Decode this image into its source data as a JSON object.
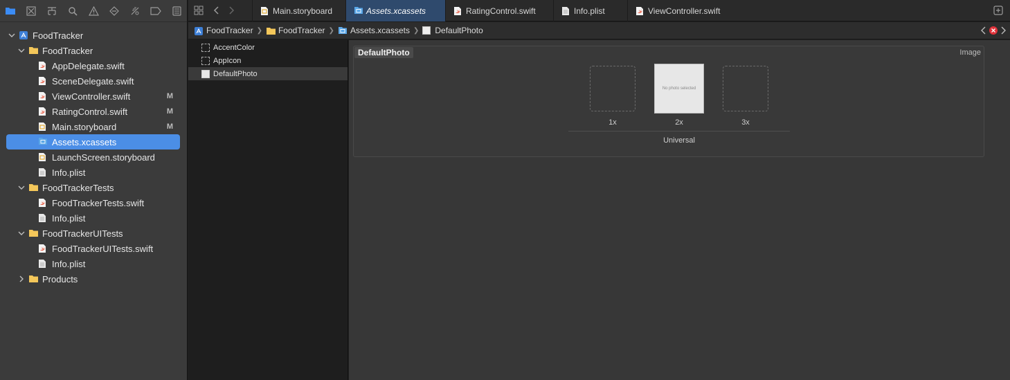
{
  "navigator_toolbar": {
    "icons": [
      "folder-icon",
      "source-control-icon",
      "symbol-icon",
      "find-icon",
      "issue-icon",
      "test-icon",
      "debug-icon",
      "breakpoint-icon",
      "report-icon"
    ]
  },
  "tree": [
    {
      "label": "FoodTracker",
      "kind": "project",
      "level": 0,
      "expanded": true
    },
    {
      "label": "FoodTracker",
      "kind": "folder",
      "level": 1,
      "expanded": true
    },
    {
      "label": "AppDelegate.swift",
      "kind": "swift",
      "level": 2
    },
    {
      "label": "SceneDelegate.swift",
      "kind": "swift",
      "level": 2
    },
    {
      "label": "ViewController.swift",
      "kind": "swift",
      "level": 2,
      "badge": "M"
    },
    {
      "label": "RatingControl.swift",
      "kind": "swift",
      "level": 2,
      "badge": "M"
    },
    {
      "label": "Main.storyboard",
      "kind": "storyboard",
      "level": 2,
      "badge": "M"
    },
    {
      "label": "Assets.xcassets",
      "kind": "assets",
      "level": 2,
      "selected": true
    },
    {
      "label": "LaunchScreen.storyboard",
      "kind": "storyboard",
      "level": 2
    },
    {
      "label": "Info.plist",
      "kind": "plist",
      "level": 2
    },
    {
      "label": "FoodTrackerTests",
      "kind": "folder",
      "level": 1,
      "expanded": true
    },
    {
      "label": "FoodTrackerTests.swift",
      "kind": "swift",
      "level": 2
    },
    {
      "label": "Info.plist",
      "kind": "plist",
      "level": 2
    },
    {
      "label": "FoodTrackerUITests",
      "kind": "folder",
      "level": 1,
      "expanded": true
    },
    {
      "label": "FoodTrackerUITests.swift",
      "kind": "swift",
      "level": 2
    },
    {
      "label": "Info.plist",
      "kind": "plist",
      "level": 2
    },
    {
      "label": "Products",
      "kind": "folder",
      "level": 1,
      "expanded": false
    }
  ],
  "tabs": [
    {
      "label": "Main.storyboard",
      "kind": "storyboard"
    },
    {
      "label": "Assets.xcassets",
      "kind": "assets",
      "active": true
    },
    {
      "label": "RatingControl.swift",
      "kind": "swift"
    },
    {
      "label": "Info.plist",
      "kind": "plist"
    },
    {
      "label": "ViewController.swift",
      "kind": "swift"
    }
  ],
  "breadcrumb": [
    {
      "label": "FoodTracker",
      "kind": "project"
    },
    {
      "label": "FoodTracker",
      "kind": "folder"
    },
    {
      "label": "Assets.xcassets",
      "kind": "assets"
    },
    {
      "label": "DefaultPhoto",
      "kind": "imageset"
    }
  ],
  "assets": [
    {
      "label": "AccentColor",
      "kind": "empty"
    },
    {
      "label": "AppIcon",
      "kind": "empty"
    },
    {
      "label": "DefaultPhoto",
      "kind": "filled",
      "selected": true
    }
  ],
  "imageset": {
    "title": "DefaultPhoto",
    "type": "Image",
    "slots": [
      {
        "scale": "1x",
        "filled": false
      },
      {
        "scale": "2x",
        "filled": true,
        "placeholder": "No photo selected"
      },
      {
        "scale": "3x",
        "filled": false
      }
    ],
    "idiom": "Universal"
  },
  "colors": {
    "selection": "#4b8ee6",
    "active_tab": "#2f4a6d",
    "swift": "#e8553b",
    "folder": "#f4c75a",
    "assets": "#5aa7e8"
  }
}
